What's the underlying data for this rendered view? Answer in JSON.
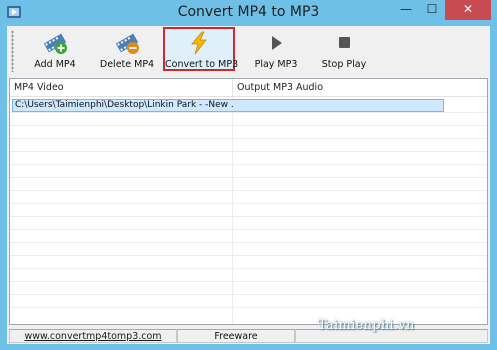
{
  "window": {
    "title": "Convert MP4 to MP3",
    "minimize": "—",
    "maximize": "☐",
    "close": "✕"
  },
  "toolbar": {
    "buttons": [
      {
        "label": "Add MP4",
        "icon": "film-add-icon"
      },
      {
        "label": "Delete MP4",
        "icon": "film-delete-icon"
      },
      {
        "label": "Convert to MP3",
        "icon": "lightning-icon"
      },
      {
        "label": "Play MP3",
        "icon": "play-icon"
      },
      {
        "label": "Stop Play",
        "icon": "stop-icon"
      }
    ]
  },
  "list": {
    "columns": [
      "MP4 Video",
      "Output MP3 Audio"
    ],
    "rows": [
      {
        "video": "C:\\Users\\Taimienphi\\Desktop\\Linkin Park - -New ...",
        "audio": ""
      }
    ]
  },
  "statusbar": {
    "url": "www.convertmp4tomp3.com",
    "license": "Freeware",
    "extra": ""
  },
  "watermark": "Taimienphi.vn",
  "colors": {
    "title_bar": "#6ec0e6",
    "close_button": "#c74b50",
    "highlight_border": "#cc2a2a",
    "selected_row": "#cde8ff"
  }
}
